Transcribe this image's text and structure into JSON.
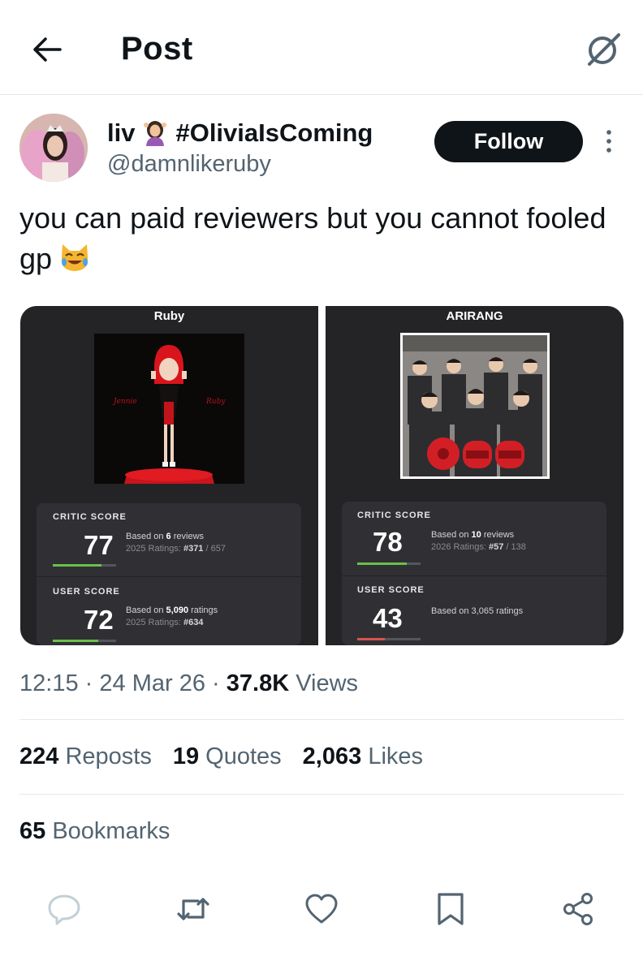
{
  "header": {
    "title": "Post",
    "back_icon": "arrow-left-icon",
    "grok_icon": "grok-slash-circle-icon"
  },
  "author": {
    "display_name": "liv",
    "hashtag_name": "#OliviaIsComing",
    "handle": "@damnlikeruby",
    "follow_label": "Follow"
  },
  "post": {
    "text": "you can paid reviewers but you cannot fooled gp"
  },
  "media": {
    "left": {
      "album": "Ruby",
      "cover_script_left": "Jennie",
      "cover_script_right": "Ruby",
      "critic": {
        "label": "CRITIC SCORE",
        "score": "77",
        "based_prefix": "Based on",
        "count": "6",
        "based_suffix": "reviews",
        "ratings_prefix": "2025 Ratings:",
        "rank": "#371",
        "rank_total": "/ 657",
        "bar_fraction": 0.77,
        "bar_color": "#6abf4b"
      },
      "user": {
        "label": "USER SCORE",
        "score": "72",
        "based_prefix": "Based on",
        "count": "5,090",
        "based_suffix": "ratings",
        "ratings_prefix": "2025 Ratings:",
        "rank": "#634",
        "bar_fraction": 0.72,
        "bar_color": "#6abf4b"
      }
    },
    "right": {
      "album": "ARIRANG",
      "critic": {
        "label": "CRITIC SCORE",
        "score": "78",
        "based_prefix": "Based on",
        "count": "10",
        "based_suffix": "reviews",
        "ratings_prefix": "2026 Ratings:",
        "rank": "#57",
        "rank_total": "/ 138",
        "bar_fraction": 0.78,
        "bar_color": "#6abf4b"
      },
      "user": {
        "label": "USER SCORE",
        "score": "43",
        "based_text": "Based on 3,065 ratings",
        "bar_fraction": 0.43,
        "bar_color": "#d9534f"
      }
    }
  },
  "meta": {
    "time": "12:15",
    "sep1": "·",
    "date": "24 Mar 26",
    "sep2": "·",
    "views_count": "37.8K",
    "views_label": "Views"
  },
  "stats": {
    "reposts_count": "224",
    "reposts_label": "Reposts",
    "quotes_count": "19",
    "quotes_label": "Quotes",
    "likes_count": "2,063",
    "likes_label": "Likes",
    "bookmarks_count": "65",
    "bookmarks_label": "Bookmarks"
  },
  "actions": [
    "reply-icon",
    "repost-icon",
    "like-icon",
    "bookmark-icon",
    "share-icon"
  ],
  "colors": {
    "text": "#0f1419",
    "secondary": "#536471",
    "divider": "#e6e8ea",
    "button_dark": "#0f1419"
  }
}
